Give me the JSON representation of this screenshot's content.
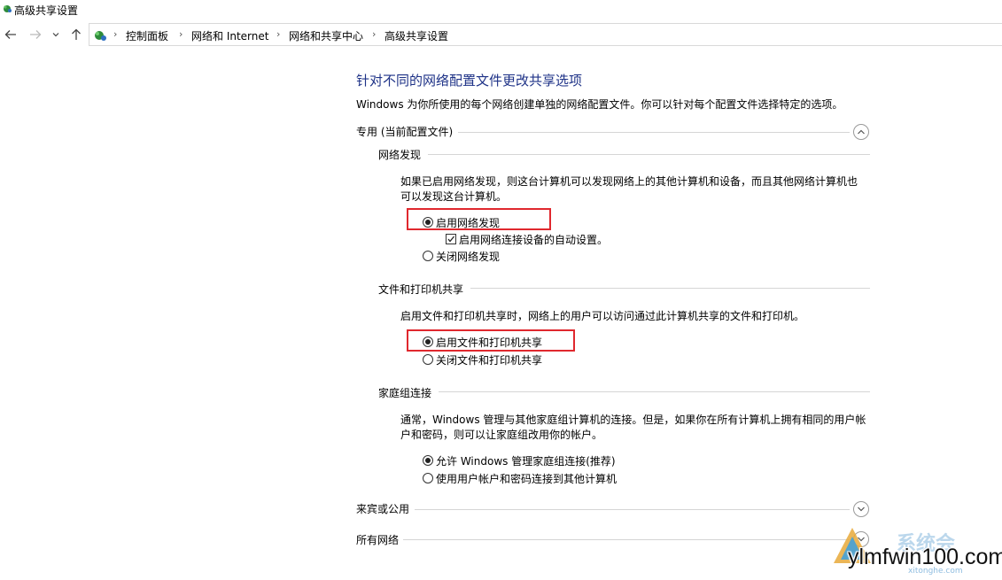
{
  "window": {
    "title": "高级共享设置",
    "app_icon": "network-globe-icon"
  },
  "navigation": {
    "back_icon": "arrow-left-icon",
    "forward_icon": "arrow-right-icon",
    "recent_icon": "chevron-down-icon",
    "up_icon": "arrow-up-icon",
    "location_icon": "control-panel-network-icon",
    "breadcrumbs": [
      "控制面板",
      "网络和 Internet",
      "网络和共享中心",
      "高级共享设置"
    ],
    "separator": "›"
  },
  "page": {
    "title": "针对不同的网络配置文件更改共享选项",
    "description": "Windows 为你所使用的每个网络创建单独的网络配置文件。你可以针对每个配置文件选择特定的选项。"
  },
  "profiles": {
    "private": {
      "header": "专用 (当前配置文件)",
      "expanded": true,
      "network_discovery": {
        "title": "网络发现",
        "text_line1": "如果已启用网络发现，则这台计算机可以发现网络上的其他计算机和设备，而且其他网络计算机也",
        "text_line2": "可以发现这台计算机。",
        "option_on": "启用网络发现",
        "option_auto": "启用网络连接设备的自动设置。",
        "option_off": "关闭网络发现",
        "selected": "on",
        "auto_setup_checked": true
      },
      "file_printer_sharing": {
        "title": "文件和打印机共享",
        "text": "启用文件和打印机共享时，网络上的用户可以访问通过此计算机共享的文件和打印机。",
        "option_on": "启用文件和打印机共享",
        "option_off": "关闭文件和打印机共享",
        "selected": "on"
      },
      "homegroup": {
        "title": "家庭组连接",
        "text_line1": "通常，Windows 管理与其他家庭组计算机的连接。但是，如果你在所有计算机上拥有相同的用户帐",
        "text_line2": "户和密码，则可以让家庭组改用你的帐户。",
        "option_allow": "允许 Windows 管理家庭组连接(推荐)",
        "option_user": "使用用户帐户和密码连接到其他计算机",
        "selected": "allow"
      }
    },
    "guest_public": {
      "header": "来宾或公用",
      "expanded": false
    },
    "all_networks": {
      "header": "所有网络",
      "expanded": false
    }
  },
  "annotations": {
    "highlight_color": "#e0282e"
  },
  "watermark": {
    "site": "ylmfwin100.com",
    "cn_text": "系统会",
    "small_text": "xitonghe.com"
  },
  "colors": {
    "title_blue": "#1e3287",
    "divider": "#d5d5d5"
  }
}
